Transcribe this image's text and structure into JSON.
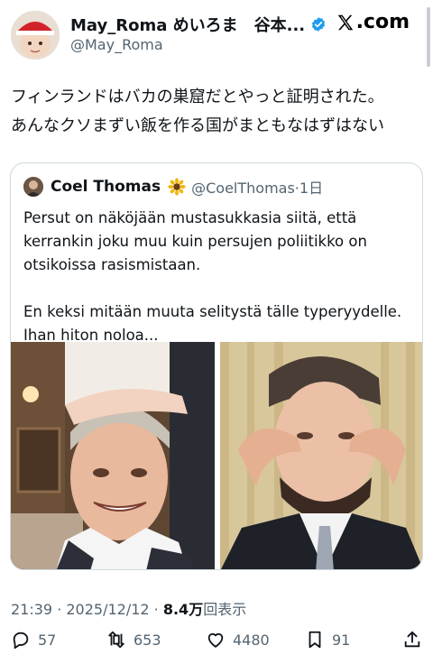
{
  "author": {
    "display_name": "May_Roma めいろま　谷本...",
    "handle": "@May_Roma"
  },
  "brand": {
    "logo_text": ".com"
  },
  "tweet": {
    "line1": "フィンランドはバカの巣窟だとやっと証明された。",
    "line2": "あんなクソまずい飯を作る国がまともなはずはない"
  },
  "quote": {
    "name": "Coel Thomas",
    "handle_date": "@CoelThomas·1日",
    "para1_line1": "Persut on näköjään mustasukkasia siitä, että",
    "para1_line2": "kerrankin joku muu kuin persujen poliitikko on",
    "para1_line3": "otsikoissa rasismistaan.",
    "para2_line1": "En keksi mitään muuta selitystä tälle typeryydelle.",
    "para2_line2": "Ihan hiton noloa..."
  },
  "meta": {
    "time_date": "21:39 · 2025/12/12 · ",
    "views": "8.4万",
    "views_label": "回表示"
  },
  "actions": {
    "replies": "57",
    "reposts": "653",
    "likes": "4480",
    "bookmarks": "91"
  },
  "colors": {
    "text": "#0f1419",
    "secondary": "#536471",
    "verified": "#1d9bf0",
    "border": "#cfd9de"
  },
  "icons": [
    "verified-badge-icon",
    "x-logo-icon",
    "sunflower-icon",
    "reply-icon",
    "repost-icon",
    "like-icon",
    "bookmark-icon",
    "share-icon"
  ]
}
